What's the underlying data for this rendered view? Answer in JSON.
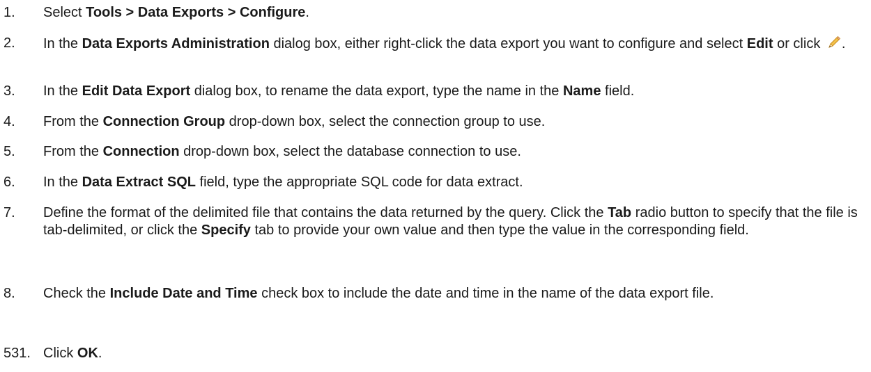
{
  "steps": [
    {
      "num": "1.",
      "parts": [
        [
          "t",
          "Select "
        ],
        [
          "b",
          "Tools > Data Exports > Configure"
        ],
        [
          "t",
          "."
        ]
      ]
    },
    {
      "num": "2.",
      "parts": [
        [
          "t",
          "In the "
        ],
        [
          "b",
          "Data Exports Administration"
        ],
        [
          "t",
          " dialog box, either right-click the data export you want to configure and select "
        ],
        [
          "b",
          "Edit"
        ],
        [
          "t",
          " or click "
        ],
        [
          "icon",
          "pencil-icon"
        ],
        [
          "t",
          "."
        ]
      ]
    },
    {
      "num": "3.",
      "parts": [
        [
          "t",
          "In the "
        ],
        [
          "b",
          "Edit Data Export"
        ],
        [
          "t",
          " dialog box, to rename the data export, type the name in the "
        ],
        [
          "b",
          "Name"
        ],
        [
          "t",
          " field."
        ]
      ]
    },
    {
      "num": "4.",
      "parts": [
        [
          "t",
          "From the "
        ],
        [
          "b",
          "Connection Group"
        ],
        [
          "t",
          " drop-down box, select the connection group to use."
        ]
      ]
    },
    {
      "num": "5.",
      "parts": [
        [
          "t",
          "From the "
        ],
        [
          "b",
          "Connection"
        ],
        [
          "t",
          " drop-down box, select the database connection to use."
        ]
      ]
    },
    {
      "num": "6.",
      "parts": [
        [
          "t",
          "In the "
        ],
        [
          "b",
          "Data Extract SQL"
        ],
        [
          "t",
          " field, type the appropriate SQL code for data extract."
        ]
      ]
    },
    {
      "num": "7.",
      "parts": [
        [
          "t",
          "Define the format of the delimited file that contains the data returned by the query. Click the "
        ],
        [
          "b",
          "Tab"
        ],
        [
          "t",
          " radio button to specify that the file is tab-delimited, or click the "
        ],
        [
          "b",
          "Specify"
        ],
        [
          "t",
          " tab to provide your own value and then type the value in the corresponding field."
        ]
      ]
    },
    {
      "num": "8.",
      "parts": [
        [
          "t",
          "Check the "
        ],
        [
          "b",
          "Include Date and Time"
        ],
        [
          "t",
          " check box to include the date and time in the name of the data export file."
        ]
      ]
    },
    {
      "num": "531.",
      "parts": [
        [
          "t",
          "Click "
        ],
        [
          "b",
          "OK"
        ],
        [
          "t",
          "."
        ]
      ]
    }
  ]
}
